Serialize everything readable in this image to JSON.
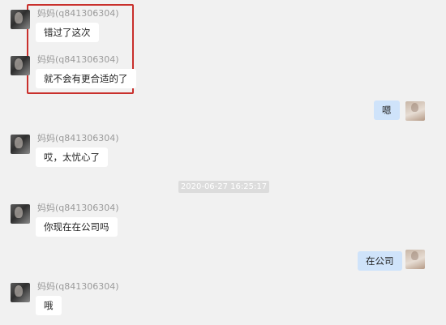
{
  "contact": {
    "display_name": "妈妈(q841306304)"
  },
  "messages": [
    {
      "sender": "contact",
      "name": "妈妈(q841306304)",
      "text": "错过了这次"
    },
    {
      "sender": "contact",
      "name": "妈妈(q841306304)",
      "text": "就不会有更合适的了"
    },
    {
      "sender": "self",
      "text": "嗯"
    },
    {
      "sender": "contact",
      "name": "妈妈(q841306304)",
      "text": "哎，太忧心了"
    },
    {
      "sender": "contact",
      "name": "妈妈(q841306304)",
      "text": "你现在在公司吗"
    },
    {
      "sender": "self",
      "text": "在公司"
    },
    {
      "sender": "contact",
      "name": "妈妈(q841306304)",
      "text": "哦"
    }
  ],
  "timestamp": "2020-06-27 16:25:17",
  "colors": {
    "background": "#f1f1f1",
    "incoming_bubble": "#ffffff",
    "outgoing_bubble": "#cfe3fa",
    "highlight_border": "#c9302c"
  }
}
